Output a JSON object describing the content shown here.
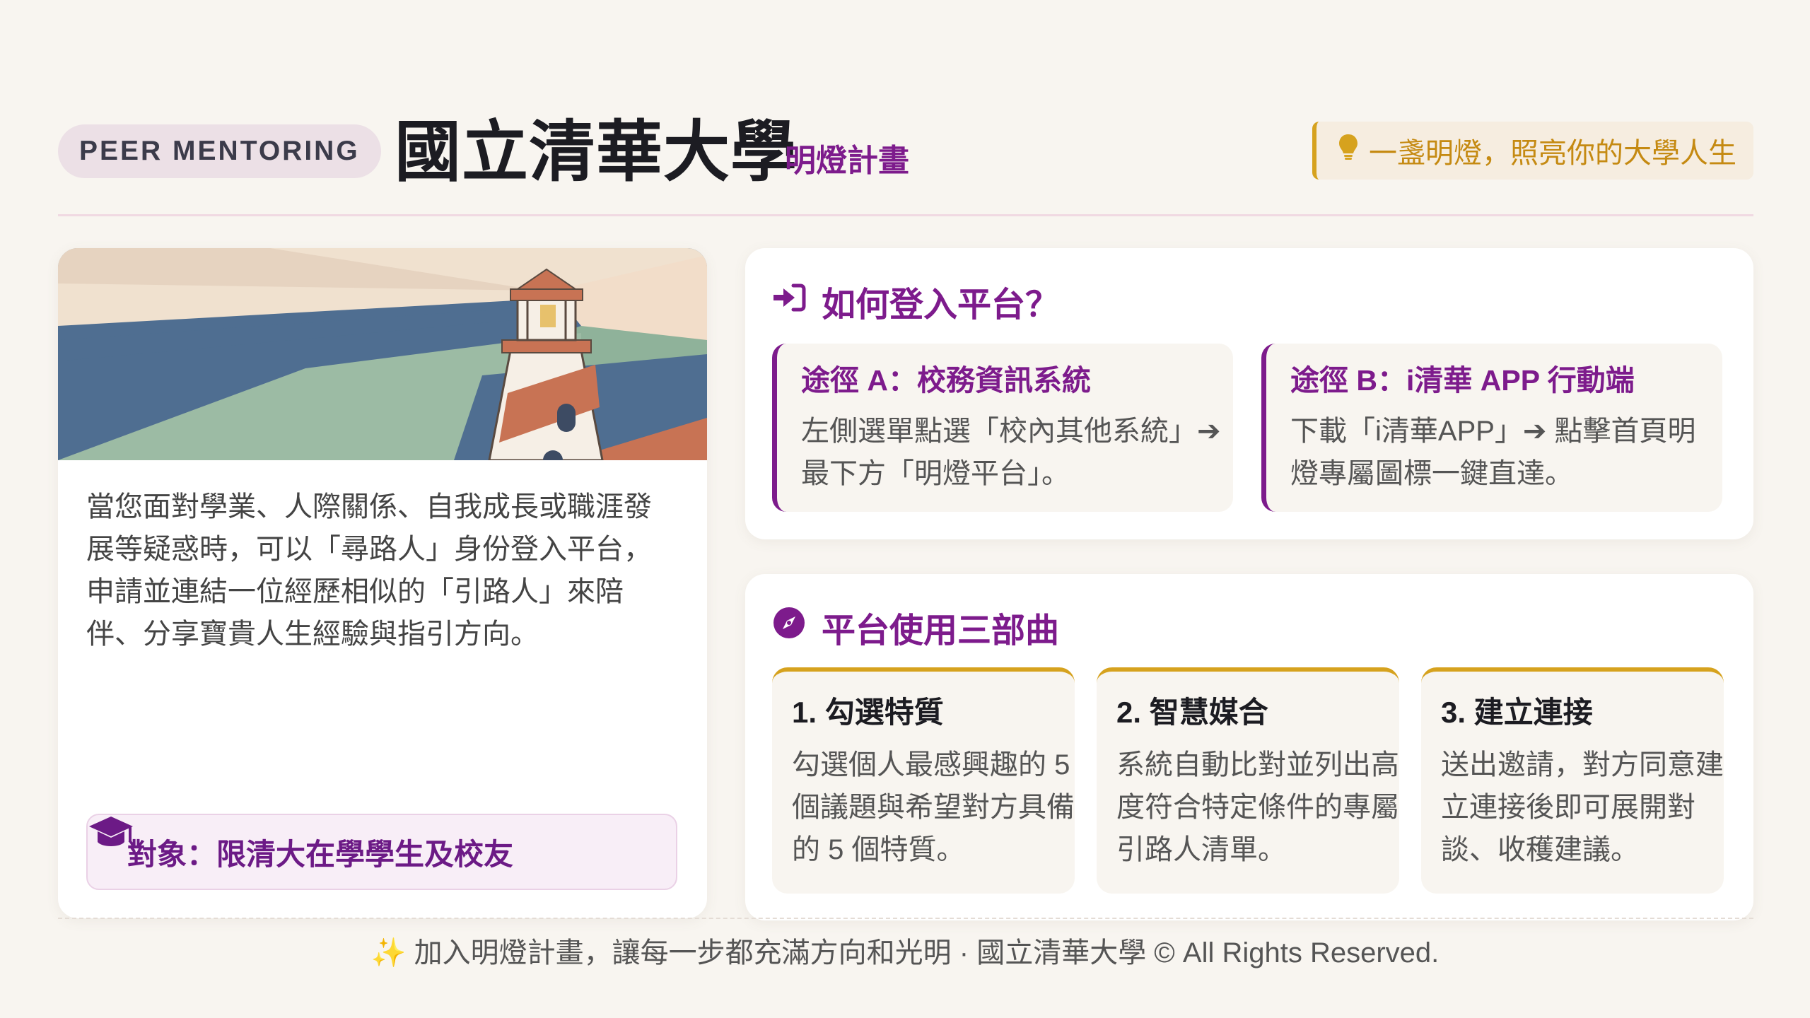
{
  "header": {
    "badge": "PEER MENTORING",
    "title": "國立清華大學",
    "subtitle": "明燈計畫",
    "slogan": "一盞明燈，照亮你的大學人生"
  },
  "intro": {
    "description": "當您面對學業、人際關係、自我成長或職涯發展等疑惑時，可以「尋路人」身份登入平台，申請並連結一位經歷相似的「引路人」來陪伴、分享寶貴人生經驗與指引方向。",
    "target": "對象：限清大在學學生及校友"
  },
  "login": {
    "title": "如何登入平台？",
    "routes": [
      {
        "title": "途徑 A：校務資訊系統",
        "text": "左側選單點選「校內其他系統」➔ 最下方「明燈平台」。"
      },
      {
        "title": "途徑 B：i清華 APP 行動端",
        "text": "下載「i清華APP」➔ 點擊首頁明燈專屬圖標一鍵直達。"
      }
    ]
  },
  "steps": {
    "title": "平台使用三部曲",
    "items": [
      {
        "title": "1. 勾選特質",
        "text": "勾選個人最感興趣的 5 個議題與希望對方具備的 5 個特質。"
      },
      {
        "title": "2. 智慧媒合",
        "text": "系統自動比對並列出高度符合特定條件的專屬引路人清單。"
      },
      {
        "title": "3. 建立連接",
        "text": "送出邀請，對方同意建立連接後即可展開對談、收穫建議。"
      }
    ]
  },
  "footer": {
    "text": "✨ 加入明燈計畫，讓每一步都充滿方向和光明 · 國立清華大學 © All Rights Reserved."
  },
  "colors": {
    "accent_purple": "#7d1b8c",
    "accent_gold": "#d6a21e",
    "background": "#f8f5f0"
  },
  "icons": [
    "lightbulb-icon",
    "sign-in-icon",
    "compass-icon",
    "graduation-cap-icon",
    "lighthouse-illustration"
  ]
}
